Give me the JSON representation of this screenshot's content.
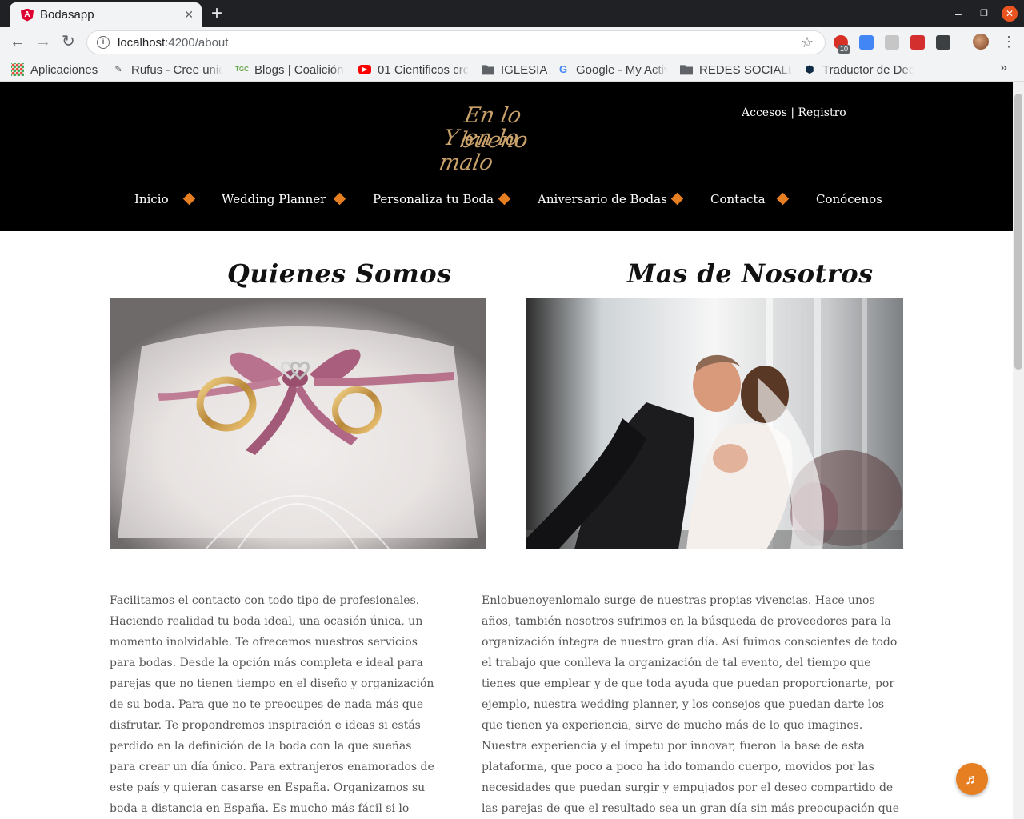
{
  "browser": {
    "tab_title": "Bodasapp",
    "tab_favicon": "A",
    "url_host": "localhost",
    "url_path": ":4200/about",
    "extension_badge": "10",
    "bookmarks": [
      {
        "label": "Aplicaciones",
        "icon": "apps-grid-icon"
      },
      {
        "label": "Rufus - Cree unid",
        "icon": "rufus-icon"
      },
      {
        "label": "Blogs | Coalición",
        "icon": "tgc-icon"
      },
      {
        "label": "01 Cientificos cre",
        "icon": "youtube-icon"
      },
      {
        "label": "IGLESIA",
        "icon": "folder-icon"
      },
      {
        "label": "Google - My Activ",
        "icon": "google-icon"
      },
      {
        "label": "REDES SOCIALES",
        "icon": "folder-icon"
      },
      {
        "label": "Traductor de Dee",
        "icon": "deepl-icon"
      }
    ]
  },
  "site": {
    "logo": {
      "line1": "En lo bueno",
      "line2": "Y en lo malo"
    },
    "auth": {
      "login": "Accesos",
      "separator": "|",
      "register": "Registro"
    },
    "nav": [
      "Inicio",
      "Wedding Planner",
      "Personaliza tu Boda",
      "Aniversario de Bodas",
      "Contacta",
      "Conócenos"
    ],
    "accent_color": "#e67e22"
  },
  "about": {
    "left": {
      "title": "Quienes Somos",
      "image": "wedding-rings-on-pillow",
      "text": "Facilitamos el contacto con todo tipo de profesionales. Haciendo realidad tu boda ideal, una ocasión única, un momento inolvidable. Te ofrecemos nuestros servicios para bodas. Desde la opción más completa e ideal para parejas que no tienen tiempo en el diseño y organización de su boda. Para que no te preocupes de nada más que disfrutar. Te propondremos inspiración e ideas si estás perdido en la definición de la boda con la que sueñas para crear un día único. Para extranjeros enamorados de este país y quieran casarse en España. Organizamos su boda a distancia en España. Es mucho más fácil si lo dejas en nuestras manos."
    },
    "right": {
      "title": "Mas de Nosotros",
      "image": "couple-dancing",
      "text": "Enlobuenoyenlomalo surge de nuestras propias vivencias. Hace unos años, también nosotros sufrimos en la búsqueda de proveedores para la organización íntegra de nuestro gran día. Así fuimos conscientes de todo el trabajo que conlleva la organización de tal evento, del tiempo que tienes que emplear y de que toda ayuda que puedan proporcionarte, por ejemplo, nuestra wedding planner, y los consejos que puedan darte los que tienen ya experiencia, sirve de mucho más de lo que imagines. Nuestra experiencia y el ímpetu por innovar, fueron la base de esta plataforma, que poco a poco ha ido tomando cuerpo, movidos por las necesidades que puedan surgir y empujados por el deseo compartido de las parejas de que el resultado sea un gran día sin más preocupación que la del disfrute de tod@s."
    }
  },
  "music_button_icon": "music-note-icon"
}
